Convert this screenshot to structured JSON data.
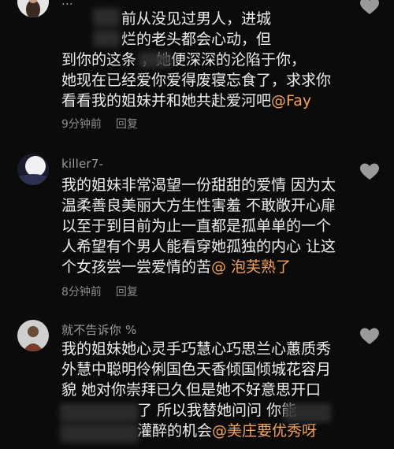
{
  "comments": [
    {
      "username": "...",
      "lines": [
        "前从没见过男人，进城",
        "烂的老头都会心动，但",
        "到你的这条      ，她便深深的沦陷于你，",
        "她现在已经爱你爱得废寝忘食了，求求你",
        "看看我的姐妹并和她共赴爱河吧"
      ],
      "mention": "@Fay",
      "time": "9分钟前",
      "reply_label": "回复",
      "like_icon": "heart-outline-icon"
    },
    {
      "username": "killer7-",
      "lines": [
        "我的姐妹非常渴望一份甜甜的爱情 因为太",
        "温柔善良美丽大方生性害羞 不敢敞开心扉",
        "以至于到目前为止一直都是孤单单的一个",
        "人希望有个男人能看穿她孤独的内心 让这",
        "个女孩尝一尝爱情的苦"
      ],
      "mention": "@ 泡芙熟了",
      "time": "8分钟前",
      "reply_label": "回复",
      "like_icon": "heart-outline-icon"
    },
    {
      "username": "就不告诉你 %",
      "lines": [
        "我的姐妹她心灵手巧慧心巧思兰心蕙质秀",
        "外慧中聪明伶俐国色天香倾国倾城花容月",
        "貌 她对你崇拜已久但是她不好意思开口",
        "了 所以我替她问问 你能",
        "灌醉的机会"
      ],
      "mention": "@美庄要优秀呀",
      "like_icon": "heart-outline-icon"
    }
  ],
  "colors": {
    "background": "#0b0b0b",
    "text": "#ececec",
    "meta": "#8d8d8d",
    "mention": "#f2a25e"
  }
}
